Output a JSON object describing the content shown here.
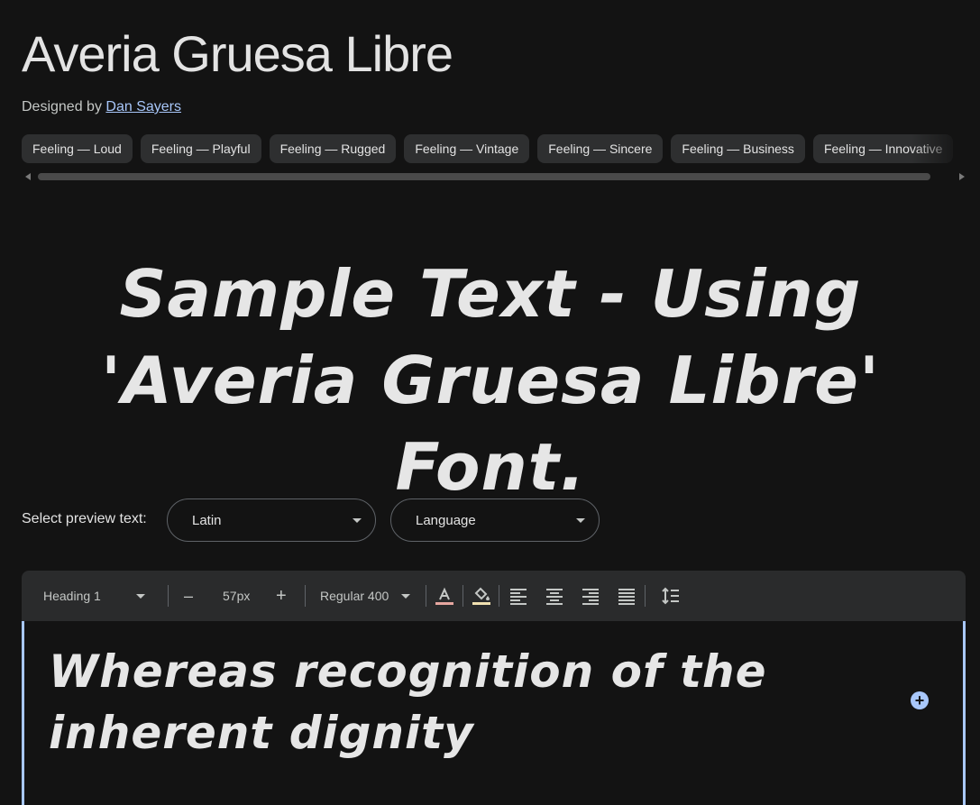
{
  "font": {
    "name": "Averia Gruesa Libre",
    "designed_by_label": "Designed by",
    "designer": "Dan Sayers"
  },
  "tags": [
    "Feeling — Loud",
    "Feeling — Playful",
    "Feeling — Rugged",
    "Feeling — Vintage",
    "Feeling — Sincere",
    "Feeling — Business",
    "Feeling — Innovative"
  ],
  "sample_text": "Sample Text - Using 'Averia Gruesa Libre' Font.",
  "preview": {
    "label": "Select preview text:",
    "script_value": "Latin",
    "language_placeholder": "Language"
  },
  "toolbar": {
    "style": "Heading 1",
    "decrease": "–",
    "size": "57px",
    "increase": "+",
    "weight": "Regular 400"
  },
  "editor": {
    "text": "Whereas recognition of the inherent dignity"
  },
  "colors": {
    "background": "#131313",
    "accent": "#a8c7fa",
    "chip": "#2e2f30"
  }
}
